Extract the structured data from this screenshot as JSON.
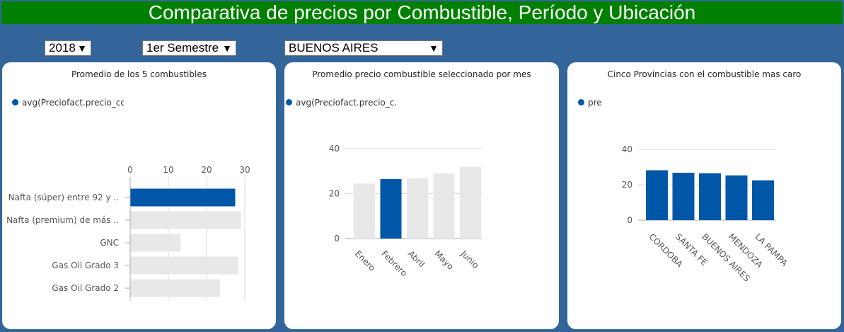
{
  "header": {
    "title": "Comparativa de precios por Combustible, Período y Ubicación"
  },
  "filters": {
    "year": "2018",
    "semester": "1er Semestre",
    "location": "BUENOS AIRES"
  },
  "colors": {
    "background": "#33659a",
    "title_bg": "#008000",
    "highlight": "#0057a8",
    "muted": "#e8e8e8"
  },
  "cards": [
    {
      "title": "Promedio de los 5 combustibles",
      "legend": "avg(Preciofact.precio_cor"
    },
    {
      "title": "Promedio precio combustible seleccionado por mes",
      "legend": "avg(Preciofact.precio_c.."
    },
    {
      "title": "Cinco Provincias con el combustible mas caro",
      "legend": "pre"
    }
  ],
  "chart_data": [
    {
      "type": "bar",
      "orientation": "horizontal",
      "categories": [
        "Nafta (súper) entre 92 y ..",
        "Nafta (premium) de más ..",
        "GNC",
        "Gas Oil Grado 3",
        "Gas Oil Grado 2"
      ],
      "values": [
        27.5,
        29,
        13.2,
        28.3,
        23.5
      ],
      "highlight_index": 0,
      "xlim": [
        0,
        30
      ],
      "ticks": [
        "0",
        "10",
        "20",
        "30"
      ]
    },
    {
      "type": "bar",
      "categories": [
        "Enero",
        "Febrero",
        "Abril",
        "Mayo",
        "Junio"
      ],
      "values": [
        24.5,
        26.5,
        26.8,
        29,
        32
      ],
      "highlight_index": 1,
      "ylim": [
        0,
        40
      ],
      "ticks": [
        "0",
        "20",
        "40"
      ]
    },
    {
      "type": "bar",
      "categories": [
        "CORDOBA",
        "SANTA FE",
        "BUENOS AIRES",
        "MENDOZA",
        "LA PAMPA"
      ],
      "values": [
        28.2,
        26.8,
        26.5,
        25.3,
        22.5
      ],
      "highlight_index": -1,
      "ylim": [
        0,
        40
      ],
      "ticks": [
        "0",
        "20",
        "40"
      ]
    }
  ]
}
